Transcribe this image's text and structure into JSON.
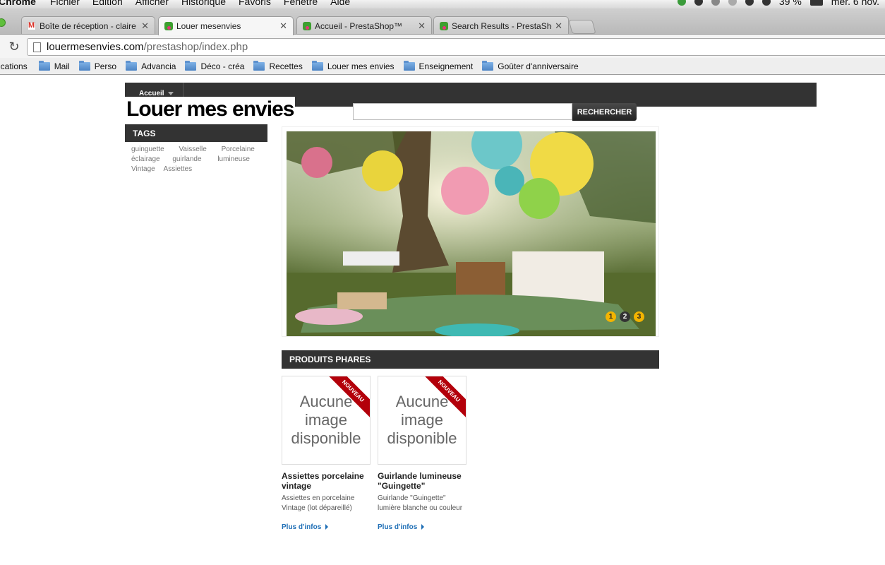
{
  "menubar": {
    "app": "Chrome",
    "items": [
      "Fichier",
      "Edition",
      "Afficher",
      "Historique",
      "Favoris",
      "Fenêtre",
      "Aide"
    ],
    "battery": "39 %",
    "date": "mer. 6 nov."
  },
  "tabs": [
    {
      "title": "Boîte de réception - claire",
      "icon": "gmail-icon",
      "active": false
    },
    {
      "title": "Louer mesenvies",
      "icon": "prestashop-icon",
      "active": true
    },
    {
      "title": "Accueil - PrestaShop™",
      "icon": "prestashop-icon",
      "active": false
    },
    {
      "title": "Search Results - PrestaShop",
      "icon": "prestashop-icon",
      "active": false
    }
  ],
  "address": {
    "host": "louermesenvies.com",
    "path": "/prestashop/index.php"
  },
  "bookmarks": {
    "apps_label": "ications",
    "folders": [
      "Mail",
      "Perso",
      "Advancia",
      "Déco - créa",
      "Recettes",
      "Louer mes envies",
      "Enseignement",
      "Goûter d'anniversaire"
    ]
  },
  "site": {
    "nav_home": "Accueil",
    "logo": "Louer mes envies",
    "search_button": "RECHERCHER",
    "search_value": "",
    "tags_title": "TAGS",
    "tags": [
      "guinguette",
      "Vaisselle",
      "Porcelaine",
      "éclairage",
      "guirlande",
      "lumineuse",
      "Vintage",
      "Assiettes"
    ],
    "slider_pager": [
      "1",
      "2",
      "3"
    ],
    "slider_active": 2,
    "featured_title": "PRODUITS PHARES",
    "products": [
      {
        "no_image": "Aucune image disponible",
        "badge": "NOUVEAU",
        "name": "Assiettes porcelaine vintage",
        "desc": "Assiettes en porcelaine Vintage (lot dépareillé)",
        "more": "Plus d'infos"
      },
      {
        "no_image": "Aucune image disponible",
        "badge": "NOUVEAU",
        "name": "Guirlande lumineuse \"Guingette\"",
        "desc": "Guirlande \"Guingette\" lumière blanche ou couleur",
        "more": "Plus d'infos"
      }
    ]
  }
}
